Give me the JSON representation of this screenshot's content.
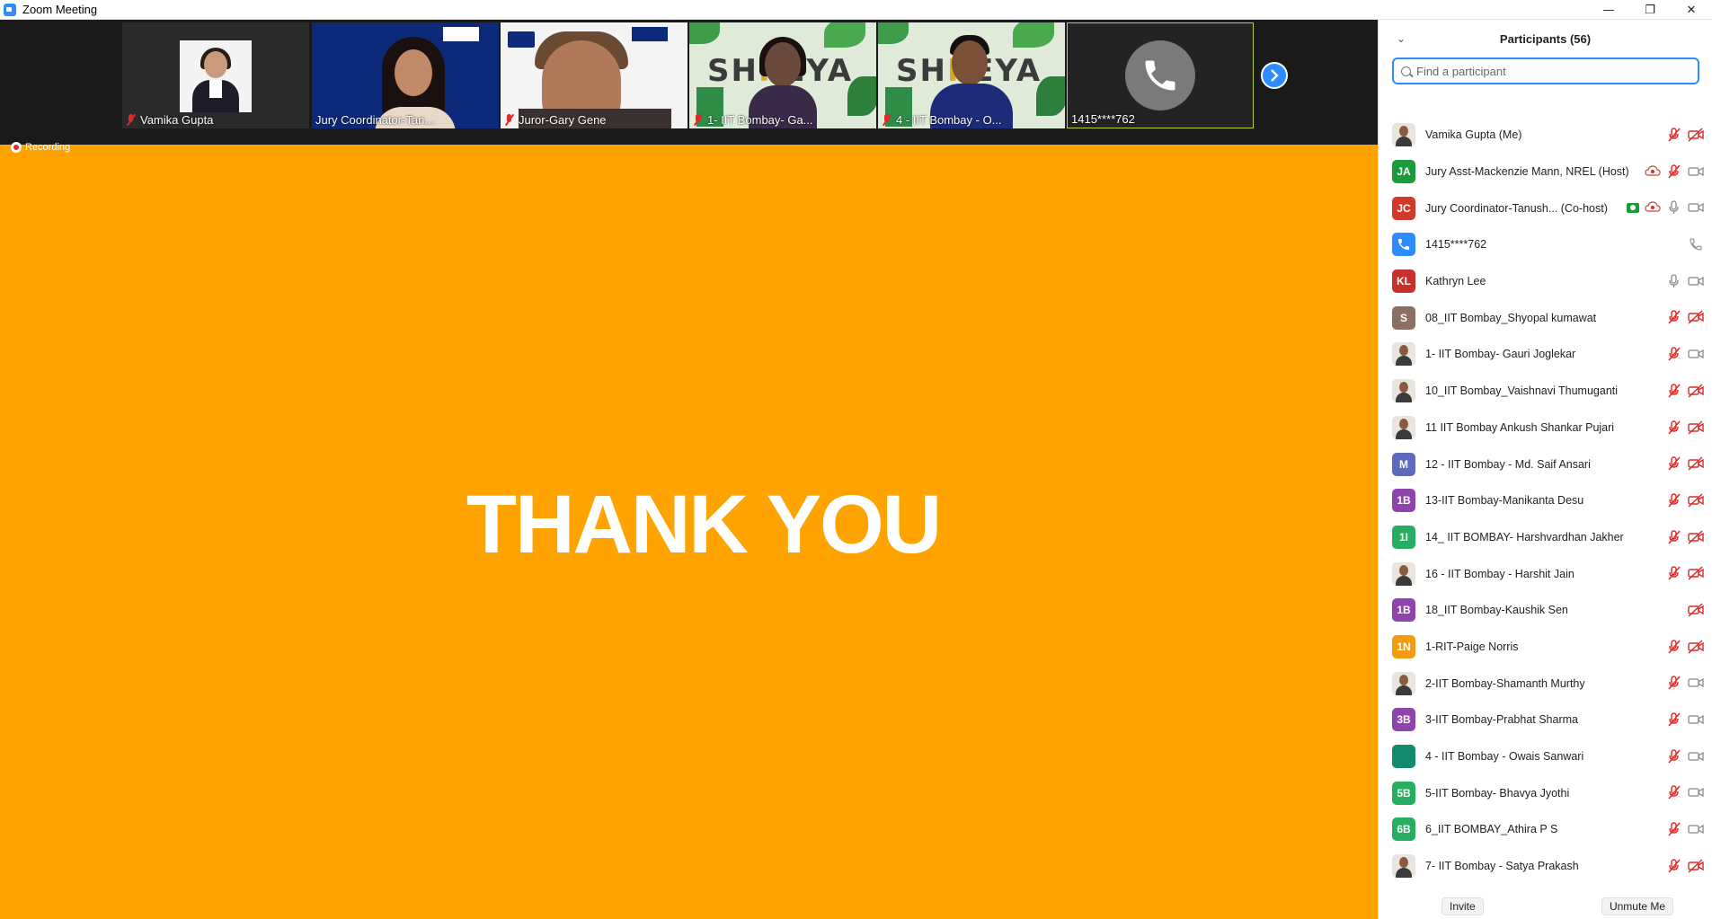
{
  "window": {
    "title": "Zoom Meeting",
    "controls": [
      "—",
      "❐",
      "✕"
    ]
  },
  "video_strip": {
    "tiles": [
      {
        "label": "Vamika Gupta",
        "muted": true
      },
      {
        "label": "Jury Coordinator-Tan...",
        "muted": false
      },
      {
        "label": "Juror-Gary Gene",
        "muted": true
      },
      {
        "label": "1- IIT Bombay- Ga...",
        "muted": true
      },
      {
        "label": "4 - IIT Bombay - O...",
        "muted": true
      },
      {
        "label": "1415****762",
        "muted": false
      }
    ]
  },
  "recording_label": "Recording",
  "slide": {
    "text": "THANK YOU",
    "background": "#ffa300"
  },
  "participants_panel": {
    "title": "Participants (56)",
    "search_placeholder": "Find a participant",
    "participants": [
      {
        "name": "Vamika Gupta (Me)",
        "avatar": "photo",
        "initials": "",
        "color": "",
        "icons": [
          "mic-off",
          "video-off"
        ]
      },
      {
        "name": "Jury Asst-Mackenzie Mann, NREL (Host)",
        "avatar": "initials",
        "initials": "JA",
        "color": "#1a9c3a",
        "icons": [
          "cloud-rec",
          "mic-off",
          "video"
        ]
      },
      {
        "name": "Jury Coordinator-Tanush... (Co-host)",
        "avatar": "initials",
        "initials": "JC",
        "color": "#d13a2a",
        "icons": [
          "share",
          "cloud-rec",
          "mic",
          "video"
        ]
      },
      {
        "name": "1415****762",
        "avatar": "phone",
        "initials": "",
        "color": "#2d8cff",
        "icons": [
          "phone"
        ]
      },
      {
        "name": "Kathryn Lee",
        "avatar": "initials",
        "initials": "KL",
        "color": "#c9302c",
        "icons": [
          "mic",
          "video"
        ]
      },
      {
        "name": "08_IIT Bombay_Shyopal kumawat",
        "avatar": "initials",
        "initials": "S",
        "color": "#8d6e63",
        "icons": [
          "mic-off",
          "video-off"
        ]
      },
      {
        "name": "1- IIT Bombay- Gauri Joglekar",
        "avatar": "photo",
        "initials": "",
        "color": "",
        "icons": [
          "mic-off",
          "video"
        ]
      },
      {
        "name": "10_IIT Bombay_Vaishnavi Thumuganti",
        "avatar": "photo",
        "initials": "",
        "color": "",
        "icons": [
          "mic-off",
          "video-off"
        ]
      },
      {
        "name": "11 IIT Bombay Ankush Shankar Pujari",
        "avatar": "photo",
        "initials": "",
        "color": "",
        "icons": [
          "mic-off",
          "video-off"
        ]
      },
      {
        "name": "12 - IIT Bombay - Md. Saif Ansari",
        "avatar": "initials",
        "initials": "M",
        "color": "#5c6bc0",
        "icons": [
          "mic-off",
          "video-off"
        ]
      },
      {
        "name": "13-IIT Bombay-Manikanta Desu",
        "avatar": "initials",
        "initials": "1B",
        "color": "#8e44ad",
        "icons": [
          "mic-off",
          "video-off"
        ]
      },
      {
        "name": "14_ IIT BOMBAY- Harshvardhan Jakher",
        "avatar": "initials",
        "initials": "1I",
        "color": "#27ae60",
        "icons": [
          "mic-off",
          "video-off"
        ]
      },
      {
        "name": "16 - IIT Bombay - Harshit Jain",
        "avatar": "photo",
        "initials": "",
        "color": "",
        "icons": [
          "mic-off",
          "video-off"
        ]
      },
      {
        "name": "18_IIT Bombay-Kaushik Sen",
        "avatar": "initials",
        "initials": "1B",
        "color": "#8e44ad",
        "icons": [
          "video-off"
        ]
      },
      {
        "name": "1-RIT-Paige Norris",
        "avatar": "initials",
        "initials": "1N",
        "color": "#f39c12",
        "icons": [
          "mic-off",
          "video-off"
        ]
      },
      {
        "name": "2-IIT Bombay-Shamanth Murthy",
        "avatar": "photo",
        "initials": "",
        "color": "",
        "icons": [
          "mic-off",
          "video"
        ]
      },
      {
        "name": "3-IIT Bombay-Prabhat Sharma",
        "avatar": "initials",
        "initials": "3B",
        "color": "#8e44ad",
        "icons": [
          "mic-off",
          "video"
        ]
      },
      {
        "name": "4 - IIT Bombay - Owais Sanwari",
        "avatar": "initials",
        "initials": "",
        "color": "#128a6e",
        "icons": [
          "mic-off",
          "video"
        ]
      },
      {
        "name": "5-IIT Bombay- Bhavya Jyothi",
        "avatar": "initials",
        "initials": "5B",
        "color": "#27ae60",
        "icons": [
          "mic-off",
          "video"
        ]
      },
      {
        "name": "6_IIT BOMBAY_Athira P S",
        "avatar": "initials",
        "initials": "6B",
        "color": "#27ae60",
        "icons": [
          "mic-off",
          "video"
        ]
      },
      {
        "name": "7- IIT Bombay - Satya Prakash",
        "avatar": "photo",
        "initials": "",
        "color": "",
        "icons": [
          "mic-off",
          "video-off"
        ]
      }
    ],
    "footer": {
      "invite_label": "Invite",
      "unmute_label": "Unmute Me"
    }
  }
}
